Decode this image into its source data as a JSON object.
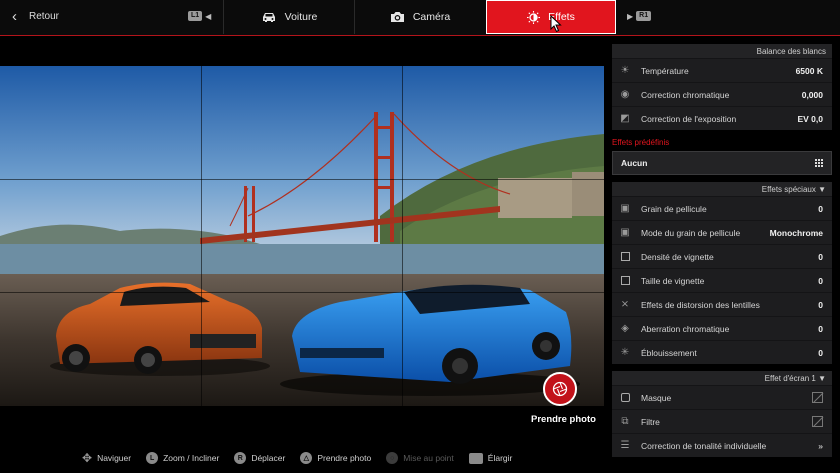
{
  "topbar": {
    "back_label": "Retour",
    "l1_badge": "L1",
    "r1_badge": "R1",
    "tabs": [
      {
        "label": "Voiture",
        "icon": "car-icon"
      },
      {
        "label": "Caméra",
        "icon": "camera-icon"
      },
      {
        "label": "Effets",
        "icon": "brightness-icon",
        "active": true
      }
    ]
  },
  "viewport": {
    "shutter_label": "Prendre photo"
  },
  "hints": [
    {
      "label": "Naviguer",
      "icon": "dpad-icon",
      "enabled": true
    },
    {
      "label": "Zoom / Incliner",
      "icon": "left-stick-icon",
      "enabled": true
    },
    {
      "label": "Déplacer",
      "icon": "right-stick-icon",
      "enabled": true
    },
    {
      "label": "Prendre photo",
      "icon": "triangle-button-icon",
      "enabled": true
    },
    {
      "label": "Mise au point",
      "icon": "focus-icon",
      "enabled": false
    },
    {
      "label": "Élargir",
      "icon": "touchpad-icon",
      "enabled": true
    }
  ],
  "panel": {
    "white_balance": {
      "header": "Balance des blancs",
      "rows": [
        {
          "label": "Température",
          "value": "6500 K",
          "icon": "sun-icon"
        },
        {
          "label": "Correction chromatique",
          "value": "0,000",
          "icon": "color-wheel-icon"
        },
        {
          "label": "Correction de l'exposition",
          "value": "EV 0,0",
          "icon": "exposure-icon"
        }
      ]
    },
    "presets": {
      "label": "Effets prédéfinis",
      "value": "Aucun"
    },
    "special": {
      "header": "Effets spéciaux ▼",
      "rows": [
        {
          "label": "Grain de pellicule",
          "value": "0",
          "icon": "film-icon"
        },
        {
          "label": "Mode du grain de pellicule",
          "value": "Monochrome",
          "icon": "film-mode-icon"
        },
        {
          "label": "Densité de vignette",
          "value": "0",
          "icon": "vignette-density-icon"
        },
        {
          "label": "Taille de vignette",
          "value": "0",
          "icon": "vignette-size-icon"
        },
        {
          "label": "Effets de distorsion des lentilles",
          "value": "0",
          "icon": "distortion-icon"
        },
        {
          "label": "Aberration chromatique",
          "value": "0",
          "icon": "aberration-icon"
        },
        {
          "label": "Éblouissement",
          "value": "0",
          "icon": "glare-icon"
        }
      ]
    },
    "screen": {
      "header": "Effet d'écran 1 ▼",
      "rows": [
        {
          "label": "Masque",
          "icon": "mask-icon"
        },
        {
          "label": "Filtre",
          "icon": "filter-icon"
        },
        {
          "label": "Correction de tonalité individuelle",
          "icon": "tone-icon"
        }
      ]
    }
  }
}
